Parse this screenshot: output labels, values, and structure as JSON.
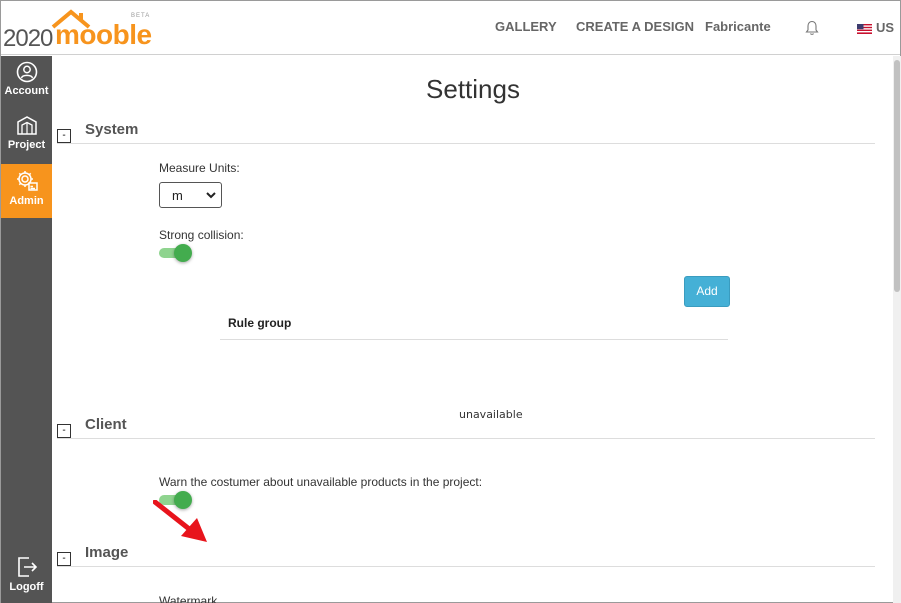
{
  "header": {
    "logo_number": "2020",
    "logo_brand": "mooble",
    "logo_badge": "BETA",
    "nav": [
      "GALLERY",
      "CREATE A DESIGN",
      "Fabricante"
    ],
    "language": "US"
  },
  "sidebar": {
    "items": [
      {
        "label": "Account",
        "icon": "account-icon"
      },
      {
        "label": "Project",
        "icon": "project-icon"
      },
      {
        "label": "Admin",
        "icon": "admin-gear-icon"
      },
      {
        "label": "Logoff",
        "icon": "logoff-icon"
      }
    ]
  },
  "page": {
    "title": "Settings"
  },
  "system": {
    "title": "System",
    "collapse": "-",
    "measure_units_label": "Measure Units:",
    "measure_units_value": "m",
    "strong_collision_label": "Strong collision:",
    "strong_collision_on": true,
    "add_label": "Add",
    "rule_group_header": "Rule group",
    "unavailable_text": "unavailable"
  },
  "client": {
    "title": "Client",
    "collapse": "-",
    "warn_label": "Warn the costumer about unavailable products in the project:",
    "warn_on": true
  },
  "image": {
    "title": "Image",
    "collapse": "-",
    "watermark_label": "Watermark"
  },
  "colors": {
    "accent": "#f7941d",
    "sidebar": "#545454",
    "toggle_on": "#43ac4e",
    "button": "#45b0d6",
    "annotation_arrow": "#e8141c"
  }
}
